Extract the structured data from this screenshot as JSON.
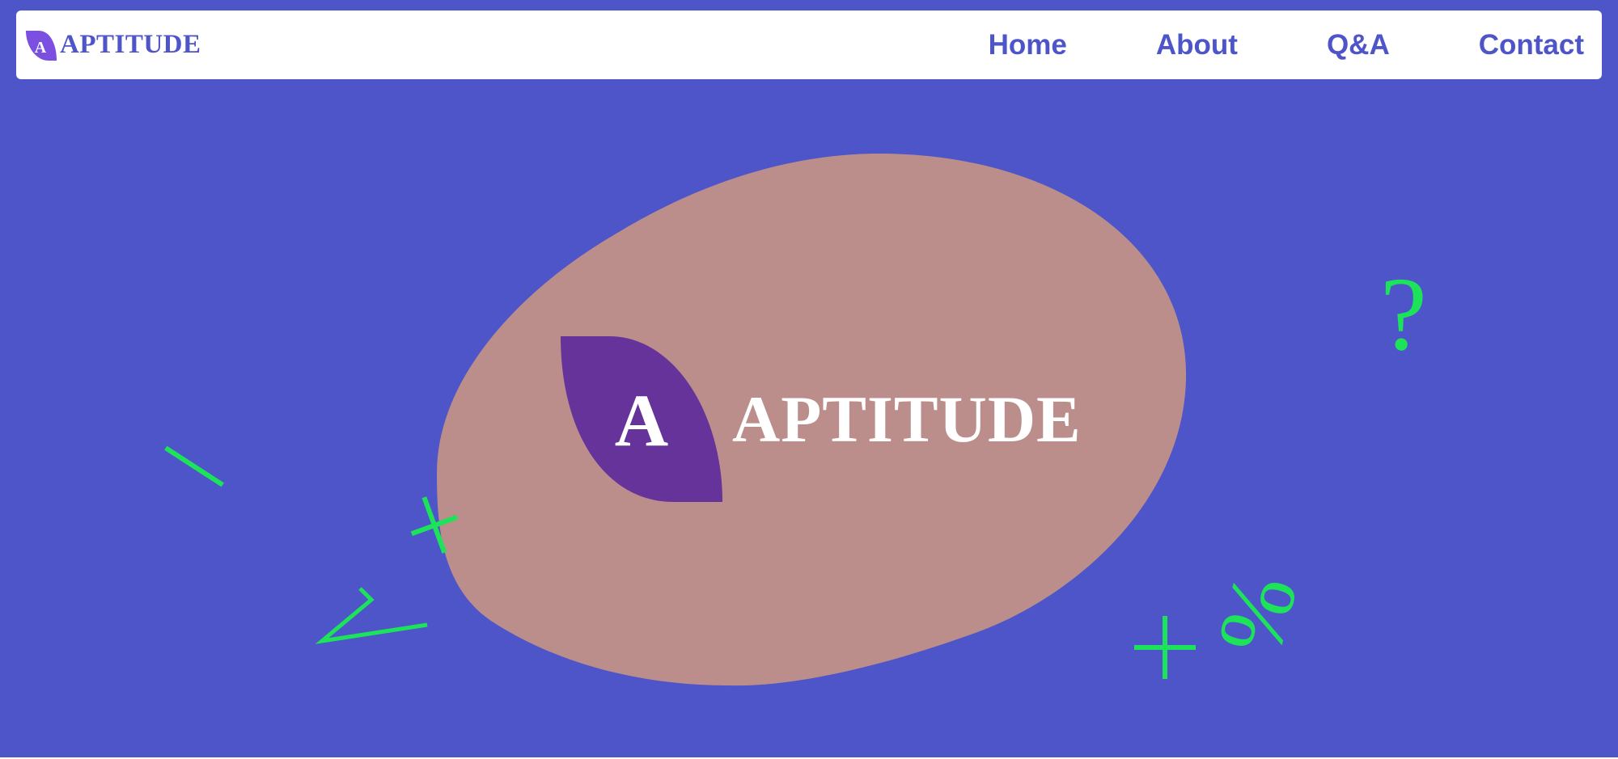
{
  "brand": {
    "name": "APTITUDE",
    "logo_letter": "A",
    "logo_icon": "leaf-logo-icon"
  },
  "nav": {
    "items": [
      {
        "label": "Home"
      },
      {
        "label": "About"
      },
      {
        "label": "Q&A"
      },
      {
        "label": "Contact"
      }
    ]
  },
  "hero": {
    "title": "APTITUDE",
    "logo_letter": "A",
    "floating_symbols": [
      "?",
      "÷",
      "÷",
      "<",
      "+",
      "%"
    ]
  },
  "colors": {
    "background": "#4e55c8",
    "navbar": "#ffffff",
    "nav_text": "#4e55c8",
    "blob": "#bb8e8c",
    "logo_leaf": "#66339b",
    "small_logo_leaf": "#7b4fe0",
    "symbols": "#1de35a",
    "hero_text": "#ffffff"
  }
}
